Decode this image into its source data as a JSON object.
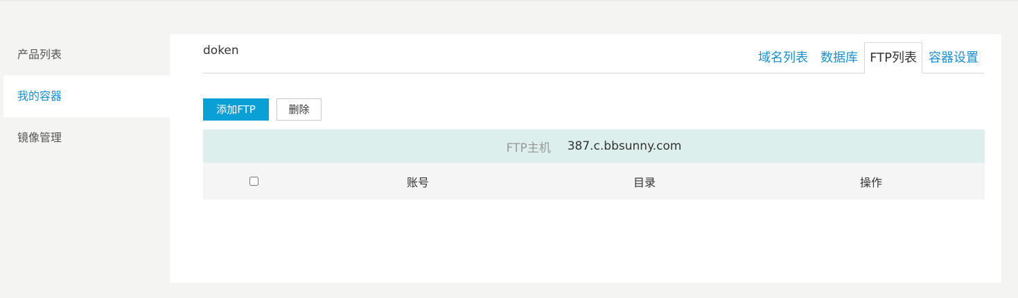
{
  "sidebar": {
    "items": [
      {
        "label": "产品列表",
        "active": false
      },
      {
        "label": "我的容器",
        "active": true
      },
      {
        "label": "镜像管理",
        "active": false
      }
    ]
  },
  "container": {
    "name": "doken"
  },
  "tabs": [
    {
      "label": "域名列表",
      "active": false
    },
    {
      "label": "数据库",
      "active": false
    },
    {
      "label": "FTP列表",
      "active": true
    },
    {
      "label": "容器设置",
      "active": false
    }
  ],
  "toolbar": {
    "add_label": "添加FTP",
    "delete_label": "删除"
  },
  "ftp_host": {
    "label": "FTP主机",
    "value": "387.c.bbsunny.com"
  },
  "table": {
    "columns": [
      "账号",
      "目录",
      "操作"
    ],
    "rows": []
  },
  "colors": {
    "accent": "#0aa0d6",
    "link": "#1a8fcf",
    "host_bar_bg": "#dcefec",
    "page_bg": "#f4f4f2"
  }
}
